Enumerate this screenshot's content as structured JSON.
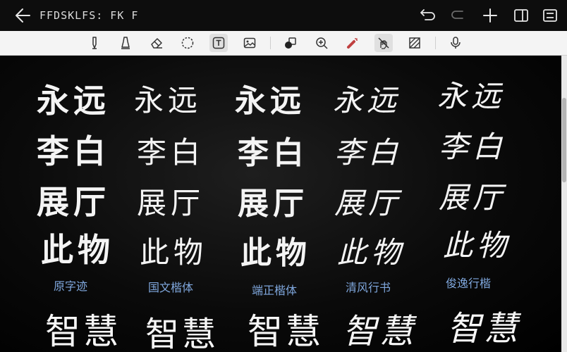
{
  "header": {
    "title": "FFDSKLFS: FK F",
    "icons": [
      "arrow-left-icon",
      "undo-icon",
      "redo-icon",
      "add-icon",
      "sidebar-icon",
      "more-icon"
    ]
  },
  "toolbar": {
    "tools": [
      {
        "name": "pen-tool",
        "icon": "pen-icon"
      },
      {
        "name": "marker-tool",
        "icon": "marker-icon"
      },
      {
        "name": "eraser-tool",
        "icon": "eraser-icon"
      },
      {
        "name": "lasso-tool",
        "icon": "lasso-icon"
      },
      {
        "name": "text-tool",
        "icon": "text-box-icon",
        "active": true
      },
      {
        "name": "image-tool",
        "icon": "image-icon"
      },
      {
        "name": "shape-tool",
        "icon": "shapes-icon"
      },
      {
        "name": "zoom-tool",
        "icon": "zoom-in-icon"
      },
      {
        "name": "laser-tool",
        "icon": "laser-pointer-icon"
      },
      {
        "name": "touch-draw-tool",
        "icon": "hand-pen-icon",
        "active": true
      },
      {
        "name": "background-tool",
        "icon": "hatch-pattern-icon"
      },
      {
        "name": "voice-tool",
        "icon": "microphone-icon"
      }
    ]
  },
  "columns": [
    {
      "words": [
        "永远",
        "李白",
        "展厅",
        "此物"
      ],
      "label": "原字迹",
      "bottom": "智慧"
    },
    {
      "words": [
        "永远",
        "李白",
        "展厅",
        "此物"
      ],
      "label": "国文楷体",
      "bottom": "智慧"
    },
    {
      "words": [
        "永远",
        "李白",
        "展厅",
        "此物"
      ],
      "label": "端正楷体",
      "bottom": "智慧"
    },
    {
      "words": [
        "永远",
        "李白",
        "展厅",
        "此物"
      ],
      "label": "清风行书",
      "bottom": "智慧"
    },
    {
      "words": [
        "永远",
        "李白",
        "展厅",
        "此物"
      ],
      "label": "俊逸行楷",
      "bottom": "智慧"
    }
  ],
  "colors": {
    "background": "#000000",
    "ink": "#f4f4f4",
    "label": "#7fa7dd",
    "toolbar": "#f4f4f4"
  }
}
